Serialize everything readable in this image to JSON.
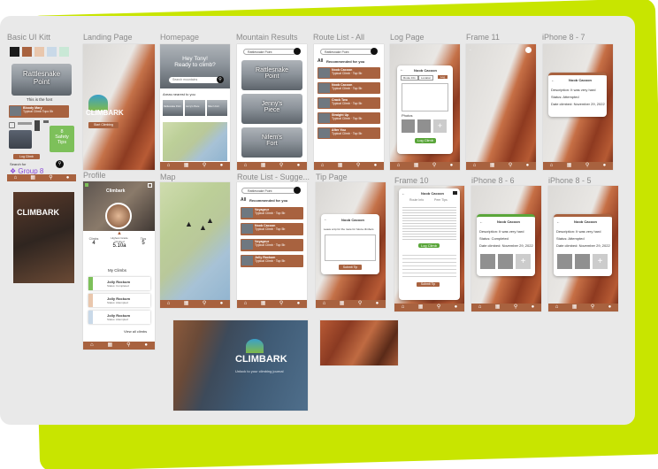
{
  "frames": {
    "basic_ui_kit": "Basic UI Kitt",
    "landing": "Landing Page",
    "homepage": "Homepage",
    "mountain_results": "Mountain Results",
    "route_list_all": "Route List - All",
    "log_page": "Log Page",
    "frame11": "Frame 11",
    "iphone87": "iPhone 8 - 7",
    "profile": "Profile",
    "map": "Map",
    "route_suggest": "Route List - Sugge...",
    "tip_page": "Tip Page",
    "frame10": "Frame 10",
    "iphone86": "iPhone 8 - 6",
    "iphone85": "iPhone 8 - 5"
  },
  "colors": {
    "lime": "#c8e500",
    "rust": "#a8623f",
    "green": "#5aa63a",
    "purple": "#8a4bd6"
  },
  "ui_kit": {
    "card_title": "Rattlesnake\nPoint",
    "font_label": "This is the font",
    "route_name": "Bloody Mary",
    "route_sub": "Typical Climb Topo 5b",
    "safety": "8\nSafety\nTips",
    "log_btn": "Log Climb",
    "search_for": "Search for",
    "group": "Group 8",
    "brand": "CLIMBARK"
  },
  "landing": {
    "brand": "CLIMBARK",
    "cta": "Start Climbing"
  },
  "homepage": {
    "greeting": "Hey Tony!\nReady to climb?",
    "search": "Search mountains",
    "areas": "Areas nearest to you",
    "tiles": [
      "Rattlesnake Point",
      "Jenny's Piece",
      "Nifen's Fort"
    ]
  },
  "mountains": {
    "search": "Rattlesnake Point",
    "tiles": [
      "Rattlesnake\nPoint",
      "Jenny's\nPiece",
      "Nifem's\nFort"
    ]
  },
  "routes_all": {
    "search": "Rattlesnake Point",
    "tab_all": "All",
    "heading": "Recommended for you",
    "items": [
      {
        "name": "Noob Cacoon",
        "sub": "Typical Climb · Top 5b"
      },
      {
        "name": "Noob Cacoon",
        "sub": "Typical Climb · Top 5b"
      },
      {
        "name": "Crack Two",
        "sub": "Typical Climb · Top 5b"
      },
      {
        "name": "Straight Up",
        "sub": "Typical Climb · Top 5b"
      },
      {
        "name": "After You",
        "sub": "Typical Climb · Top 5b"
      }
    ]
  },
  "log": {
    "title": "Noob Cacoon",
    "tabs": [
      "Route Info",
      "Location",
      "Log"
    ],
    "photos": "Photos",
    "button": "Log Climb"
  },
  "iphone87": {
    "title": "Noob Cacoon",
    "desc": "Description: It was very hard",
    "status": "Status: Attempted",
    "date": "Date climbed: November 29, 2022"
  },
  "profile": {
    "brand": "Climbark",
    "stats": [
      {
        "label": "Climbs",
        "value": "4"
      },
      {
        "label": "Highest Grade Climbed",
        "value": "5.10a"
      },
      {
        "label": "Tips",
        "value": "5"
      }
    ],
    "my_climbs": "My Climbs",
    "climbs": [
      {
        "name": "Jolly Rockum",
        "status": "Status: Completed"
      },
      {
        "name": "Jolly Rockum",
        "status": "Status: Attempted"
      },
      {
        "name": "Jolly Rockum",
        "status": "Status: Attempted"
      }
    ],
    "view_all": "View all climbs"
  },
  "route_suggest": {
    "search": "Rattlesnake Point",
    "tab_all": "All",
    "heading": "Recommended for you",
    "items": [
      {
        "name": "Voyageur",
        "sub": "Typical Climb · Top 5b"
      },
      {
        "name": "Noob Cacoon",
        "sub": "Typical Climb · Top 5b"
      },
      {
        "name": "Voyageur",
        "sub": "Typical Climb · Top 5b"
      },
      {
        "name": "Jolly Rockum",
        "sub": "Typical Climb · Top 5b"
      }
    ]
  },
  "tip": {
    "title": "Noob Cacoon",
    "prompt": "Leave a tip for the route for future climbers",
    "button": "Submit Tip"
  },
  "frame10": {
    "title": "Noob Cacoon",
    "tabs": [
      "Route Info",
      "Peer Tips"
    ],
    "button": "Log Climb",
    "button2": "Submit Tip"
  },
  "iphone86": {
    "title": "Noob Cacoon",
    "desc": "Description: It was very hard",
    "status": "Status: Completed",
    "date": "Date climbed: November 29, 2022"
  },
  "iphone85": {
    "title": "Noob Cacoon",
    "desc": "Description: It was very hard",
    "status": "Status: Attempted",
    "date": "Date climbed: November 29, 2022"
  },
  "splash": {
    "brand": "CLIMBARK",
    "tagline": "Unlock to your climbing journal"
  }
}
